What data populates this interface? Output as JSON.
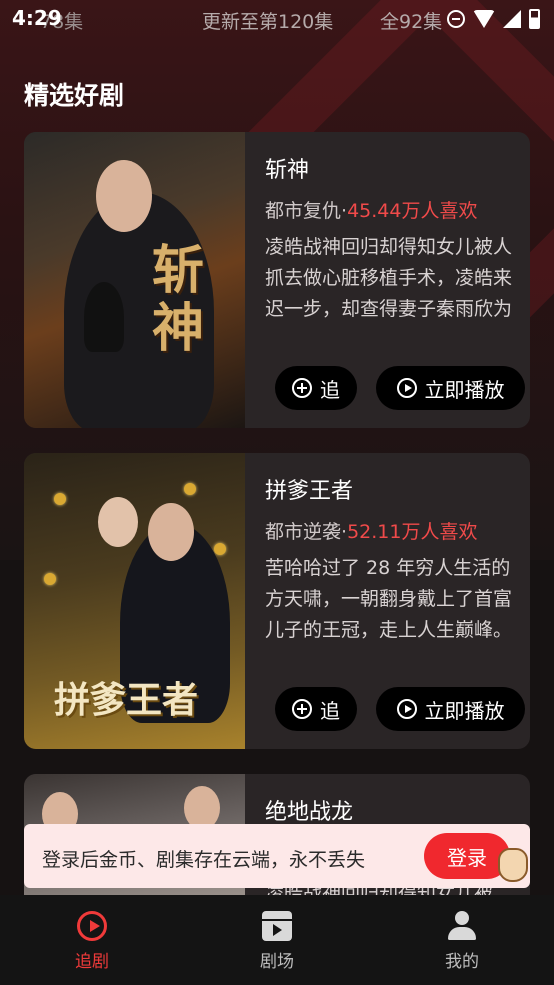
{
  "status_bar": {
    "time": "4:29",
    "overlap_left": "78集",
    "overlap_center": "更新至第120集",
    "overlap_right": "全92集",
    "icons": [
      "dnd-icon",
      "wifi-icon",
      "signal-icon",
      "battery-icon"
    ]
  },
  "section": {
    "title": "精选好剧"
  },
  "cards": [
    {
      "title": "斩神",
      "genre": "都市复仇",
      "separator": "·",
      "likes": "45.44万人喜欢",
      "description": "凌皓战神回归却得知女儿被人抓去做心脏移植手术，凌皓来迟一步，却查得妻子秦雨欣为求孙涛救女儿不惜…",
      "follow_label": "追",
      "play_label": "立即播放",
      "poster_art": "斩神"
    },
    {
      "title": "拼爹王者",
      "genre": "都市逆袭",
      "separator": "·",
      "likes": "52.11万人喜欢",
      "description": "苦哈哈过了 28 年穷人生活的方天啸，一朝翻身戴上了首富儿子的王冠，走上人生巅峰。",
      "follow_label": "追",
      "play_label": "立即播放",
      "poster_art": "拼爹王者"
    },
    {
      "title": "绝地战龙",
      "description_partial": "凌皓战神回归却得知女儿被"
    }
  ],
  "login_banner": {
    "text": "登录后金币、剧集存在云端，永不丢失",
    "button": "登录"
  },
  "bottom_nav": [
    {
      "label": "追剧",
      "active": true
    },
    {
      "label": "剧场",
      "active": false
    },
    {
      "label": "我的",
      "active": false
    }
  ],
  "colors": {
    "accent": "#f0282e",
    "likes": "#f04a4a",
    "card_bg": "#2a2526",
    "banner_bg": "#fde8e8"
  }
}
